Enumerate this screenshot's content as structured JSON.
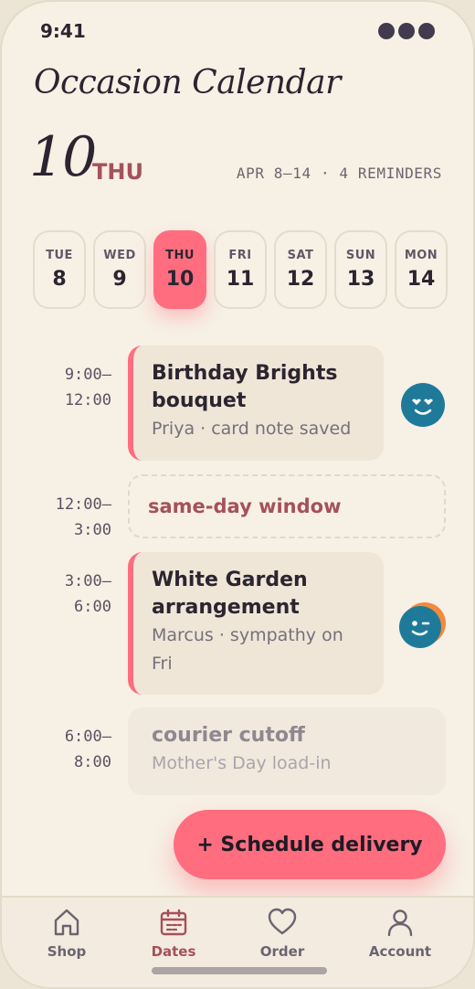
{
  "status_bar": {
    "time": "9:41"
  },
  "header": {
    "title": "Occasion Calendar",
    "day_number": "10",
    "day_name": "THU",
    "range_meta": "APR 8–14 · 4 REMINDERS"
  },
  "week": [
    {
      "dow": "TUE",
      "num": "8",
      "selected": false
    },
    {
      "dow": "WED",
      "num": "9",
      "selected": false
    },
    {
      "dow": "THU",
      "num": "10",
      "selected": true
    },
    {
      "dow": "FRI",
      "num": "11",
      "selected": false
    },
    {
      "dow": "SAT",
      "num": "12",
      "selected": false
    },
    {
      "dow": "SUN",
      "num": "13",
      "selected": false
    },
    {
      "dow": "MON",
      "num": "14",
      "selected": false
    }
  ],
  "schedule": {
    "slot1": {
      "time_start": "9:00–",
      "time_end": "12:00",
      "title_line1": "Birthday Brights",
      "title_line2": "bouquet",
      "subtitle": "Priya · card note saved",
      "avatar_icon": "heart-eyes-face-icon"
    },
    "slot2": {
      "time_start": "12:00–",
      "time_end": "3:00",
      "label": "same-day window"
    },
    "slot3": {
      "time_start": "3:00–",
      "time_end": "6:00",
      "title_line1": "White Garden",
      "title_line2": "arrangement",
      "subtitle_line1": "Marcus · sympathy on",
      "subtitle_line2": "Fri",
      "avatar_icon": "winking-face-icon"
    },
    "slot4": {
      "time_start": "6:00–",
      "time_end": "8:00",
      "title": "courier cutoff",
      "subtitle": "Mother's Day load-in"
    }
  },
  "cta": {
    "label": "+ Schedule delivery"
  },
  "tabs": [
    {
      "label": "Shop",
      "icon": "home-icon"
    },
    {
      "label": "Dates",
      "icon": "calendar-icon",
      "active": true
    },
    {
      "label": "Order",
      "icon": "heart-icon"
    },
    {
      "label": "Account",
      "icon": "person-icon"
    }
  ],
  "colors": {
    "accent": "#ff6d7f",
    "maroon": "#a4515a",
    "background": "#f7f0e5",
    "avatar_blue": "#1f7a9a",
    "avatar_orange": "#f08a3e"
  }
}
